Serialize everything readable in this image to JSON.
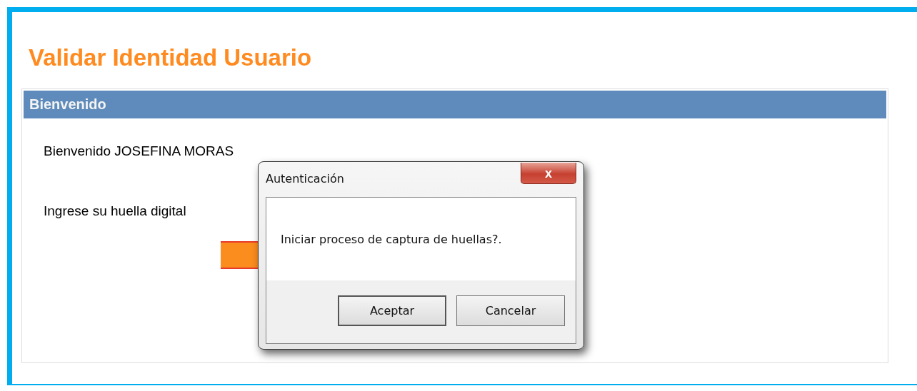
{
  "page": {
    "title": "Validar Identidad Usuario"
  },
  "panel": {
    "header": "Bienvenido",
    "welcome": "Bienvenido JOSEFINA MORAS",
    "instruction": "Ingrese su huella digital"
  },
  "dialog": {
    "title": "Autenticación",
    "close": "x",
    "message": "Iniciar proceso de captura de huellas?.",
    "buttons": [
      "Aceptar",
      "Cancelar"
    ]
  }
}
